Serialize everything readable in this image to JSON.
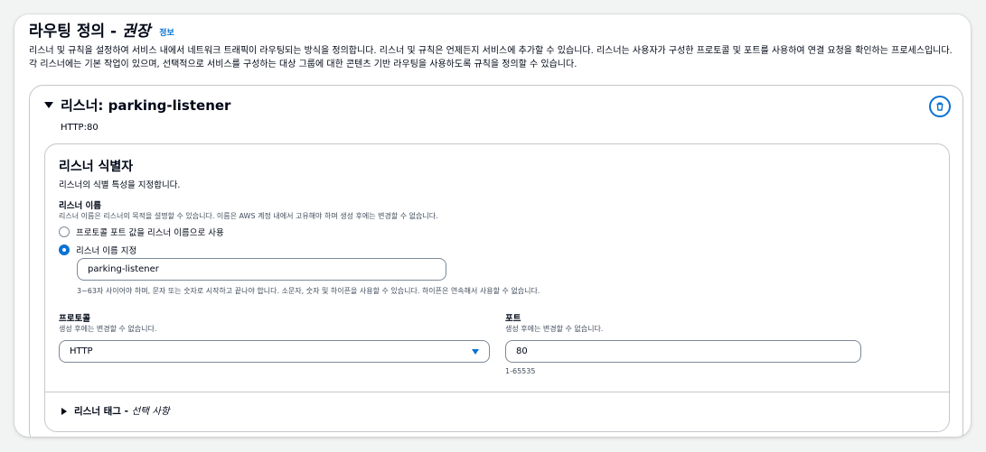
{
  "section": {
    "title": "라우팅 정의 - ",
    "title_italic": "권장",
    "info_link": "정보",
    "description": "리스너 및 규칙을 설정하여 서비스 내에서 네트워크 트래픽이 라우팅되는 방식을 정의합니다. 리스너 및 규칙은 언제든지 서비스에 추가할 수 있습니다. 리스너는 사용자가 구성한 프로토콜 및 포트를 사용하여 연결 요청을 확인하는 프로세스입니다. 각 리스너에는 기본 작업이 있으며, 선택적으로 서비스를 구성하는 대상 그룹에 대한 콘텐츠 기반 라우팅을 사용하도록 규칙을 정의할 수 있습니다."
  },
  "listener": {
    "header": "리스너: parking-listener",
    "protocol_port": "HTTP:80",
    "delete_icon": "trash-icon",
    "identifier": {
      "title": "리스너 식별자",
      "description": "리스너의 식별 특성을 지정합니다.",
      "name_label": "리스너 이름",
      "name_desc": "리스너 이름은 리스너의 목적을 설명할 수 있습니다. 이름은 AWS 계정 내에서 고유해야 하며 생성 후에는 변경할 수 없습니다.",
      "radio_default": "프로토콜 포트 값을 리스너 이름으로 사용",
      "radio_custom": "리스너 이름 지정",
      "name_value": "parking-listener",
      "name_hint": "3~63자 사이어야 하며, 문자 또는 숫자로 시작하고 끝나야 합니다. 소문자, 숫자 및 하이픈을 사용할 수 있습니다. 하이픈은 연속해서 사용할 수 없습니다.",
      "protocol_label": "프로토콜",
      "protocol_desc": "생성 후에는 변경할 수 없습니다.",
      "protocol_value": "HTTP",
      "port_label": "포트",
      "port_desc": "생성 후에는 변경할 수 없습니다.",
      "port_value": "80",
      "port_hint": "1-65535"
    },
    "tags": {
      "label": "리스너 태그 - ",
      "label_italic": "선택 사항"
    }
  },
  "colors": {
    "accent": "#0972d3",
    "border": "#c6c6cd",
    "text": "#000716"
  }
}
